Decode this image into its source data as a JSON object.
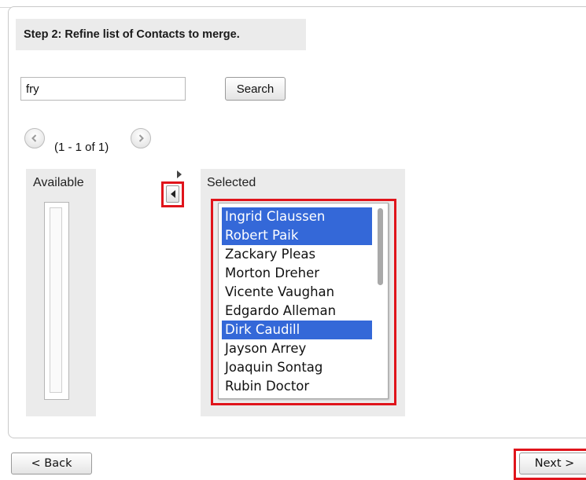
{
  "step": {
    "title": "Step 2: Refine list of Contacts to merge."
  },
  "search": {
    "value": "fry",
    "button_label": "Search"
  },
  "pager": {
    "text": "(1 - 1 of 1)",
    "prev_icon": "chevron-left-icon",
    "next_icon": "chevron-right-icon"
  },
  "available": {
    "label": "Available",
    "items": []
  },
  "selected": {
    "label": "Selected",
    "items": [
      {
        "name": "Ingrid Claussen",
        "highlighted": true
      },
      {
        "name": "Robert Paik",
        "highlighted": true
      },
      {
        "name": "Zackary Pleas",
        "highlighted": false
      },
      {
        "name": "Morton Dreher",
        "highlighted": false
      },
      {
        "name": "Vicente Vaughan",
        "highlighted": false
      },
      {
        "name": "Edgardo Alleman",
        "highlighted": false
      },
      {
        "name": "Dirk Caudill",
        "highlighted": true
      },
      {
        "name": "Jayson Arrey",
        "highlighted": false
      },
      {
        "name": "Joaquin Sontag",
        "highlighted": false
      },
      {
        "name": "Rubin Doctor",
        "highlighted": false
      }
    ]
  },
  "footer": {
    "back_label": "< Back",
    "next_label": "Next >"
  },
  "colors": {
    "selection": "#3468d8",
    "highlight_border": "#e0141b",
    "panel_bg": "#ebebeb"
  }
}
